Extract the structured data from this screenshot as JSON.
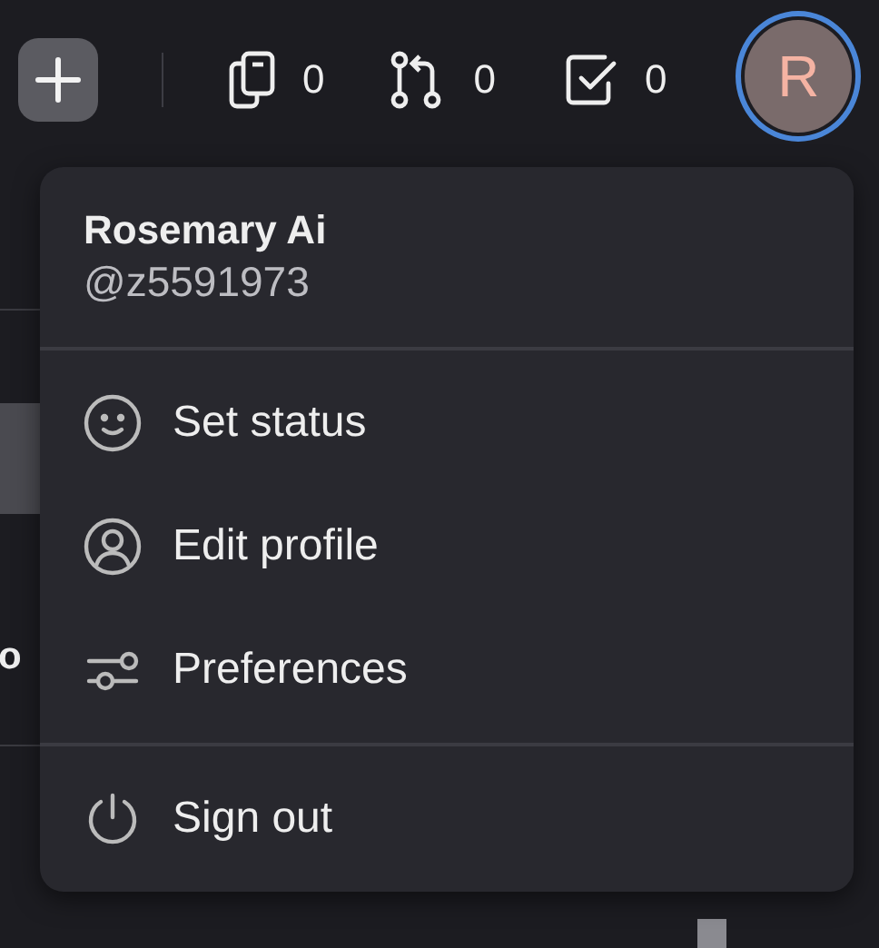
{
  "top_bar": {
    "counters": [
      {
        "kind": "copies",
        "count": "0"
      },
      {
        "kind": "pulls",
        "count": "0"
      },
      {
        "kind": "tasks",
        "count": "0"
      }
    ],
    "avatar": {
      "initial": "R"
    }
  },
  "background": {
    "fragment": "o"
  },
  "account_menu": {
    "name": "Rosemary Ai",
    "handle": "@z5591973",
    "sections": [
      [
        {
          "kind": "status",
          "label": "Set status"
        },
        {
          "kind": "profile",
          "label": "Edit profile"
        },
        {
          "kind": "preferences",
          "label": "Preferences"
        }
      ],
      [
        {
          "kind": "signout",
          "label": "Sign out"
        }
      ]
    ]
  }
}
